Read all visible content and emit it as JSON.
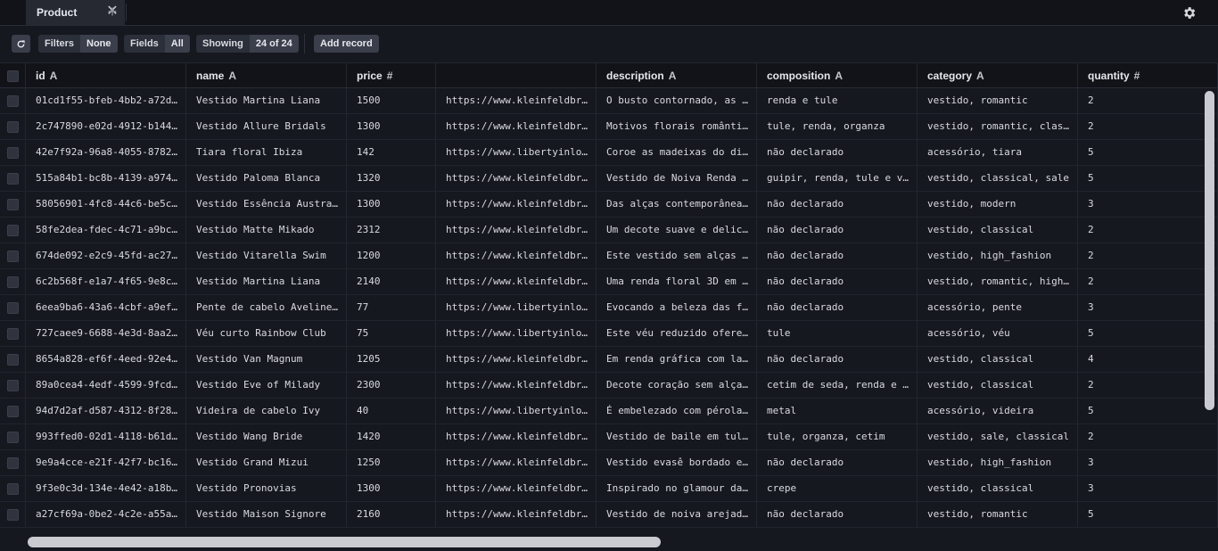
{
  "tabs": {
    "active_label": "Product",
    "close_glyph": "✕",
    "add_glyph": "+"
  },
  "toolbar": {
    "filters_label": "Filters",
    "filters_value": "None",
    "fields_label": "Fields",
    "fields_value": "All",
    "showing_label": "Showing",
    "showing_value": "24 of 24",
    "add_record_label": "Add record"
  },
  "columns": [
    {
      "name": "id",
      "type": "A"
    },
    {
      "name": "name",
      "type": "A"
    },
    {
      "name": "price",
      "type": "#"
    },
    {
      "name": "",
      "type": ""
    },
    {
      "name": "description",
      "type": "A"
    },
    {
      "name": "composition",
      "type": "A"
    },
    {
      "name": "category",
      "type": "A"
    },
    {
      "name": "quantity",
      "type": "#"
    }
  ],
  "rows": [
    [
      "01cd1f55-bfeb-4bb2-a72d…",
      "Vestido Martina Liana",
      "1500",
      "https://www.kleinfeldbr…",
      "O busto contornado, as …",
      "renda e tule",
      "vestido, romantic",
      "2"
    ],
    [
      "2c747890-e02d-4912-b144…",
      "Vestido Allure Bridals",
      "1300",
      "https://www.kleinfeldbr…",
      "Motivos florais românti…",
      "tule, renda, organza",
      "vestido, romantic, clas…",
      "2"
    ],
    [
      "42e7f92a-96a8-4055-8782…",
      "Tiara floral Ibiza",
      "142",
      "https://www.libertyinlo…",
      "Coroe as madeixas do di…",
      "não declarado",
      "acessório, tiara",
      "5"
    ],
    [
      "515a84b1-bc8b-4139-a974…",
      "Vestido Paloma Blanca",
      "1320",
      "https://www.kleinfeldbr…",
      "Vestido de Noiva Renda …",
      "guipir, renda, tule e v…",
      "vestido, classical, sale",
      "5"
    ],
    [
      "58056901-4fc8-44c6-be5c…",
      "Vestido Essência Austra…",
      "1300",
      "https://www.kleinfeldbr…",
      "Das alças contemporânea…",
      "não declarado",
      "vestido, modern",
      "3"
    ],
    [
      "58fe2dea-fdec-4c71-a9bc…",
      "Vestido Matte Mikado",
      "2312",
      "https://www.kleinfeldbr…",
      "Um decote suave e delic…",
      "não declarado",
      "vestido, classical",
      "2"
    ],
    [
      "674de092-e2c9-45fd-ac27…",
      "Vestido Vitarella Swim",
      "1200",
      "https://www.kleinfeldbr…",
      "Este vestido sem alças …",
      "não declarado",
      "vestido, high_fashion",
      "2"
    ],
    [
      "6c2b568f-e1a7-4f65-9e8c…",
      "Vestido Martina Liana",
      "2140",
      "https://www.kleinfeldbr…",
      "Uma renda floral 3D em …",
      "não declarado",
      "vestido, romantic, high…",
      "2"
    ],
    [
      "6eea9ba6-43a6-4cbf-a9ef…",
      "Pente de cabelo Aveline…",
      "77",
      "https://www.libertyinlo…",
      "Evocando a beleza das f…",
      "não declarado",
      "acessório, pente",
      "3"
    ],
    [
      "727caee9-6688-4e3d-8aa2…",
      "Véu curto Rainbow Club",
      "75",
      "https://www.libertyinlo…",
      "Este véu reduzido ofere…",
      "tule",
      "acessório, véu",
      "5"
    ],
    [
      "8654a828-ef6f-4eed-92e4…",
      "Vestido Van Magnum",
      "1205",
      "https://www.kleinfeldbr…",
      "Em renda gráfica com la…",
      "não declarado",
      "vestido, classical",
      "4"
    ],
    [
      "89a0cea4-4edf-4599-9fcd…",
      "Vestido Eve of Milady",
      "2300",
      "https://www.kleinfeldbr…",
      "Decote coração sem alça…",
      "cetim de seda, renda e …",
      "vestido, classical",
      "2"
    ],
    [
      "94d7d2af-d587-4312-8f28…",
      "Videira de cabelo Ivy",
      "40",
      "https://www.libertyinlo…",
      "É embelezado com pérola…",
      "metal",
      "acessório, videira",
      "5"
    ],
    [
      "993ffed0-02d1-4118-b61d…",
      "Vestido Wang Bride",
      "1420",
      "https://www.kleinfeldbr…",
      "Vestido de baile em tul…",
      "tule, organza, cetim",
      "vestido, sale, classical",
      "2"
    ],
    [
      "9e9a4cce-e21f-42f7-bc16…",
      "Vestido Grand Mizui",
      "1250",
      "https://www.kleinfeldbr…",
      "Vestido evasê bordado e…",
      "não declarado",
      "vestido, high_fashion",
      "3"
    ],
    [
      "9f3e0c3d-134e-4e42-a18b…",
      "Vestido Pronovias",
      "1300",
      "https://www.kleinfeldbr…",
      "Inspirado no glamour da…",
      "crepe",
      "vestido, classical",
      "3"
    ],
    [
      "a27cf69a-0be2-4c2e-a55a…",
      "Vestido Maison Signore",
      "2160",
      "https://www.kleinfeldbr…",
      "Vestido de noiva arejad…",
      "não declarado",
      "vestido, romantic",
      "5"
    ]
  ]
}
